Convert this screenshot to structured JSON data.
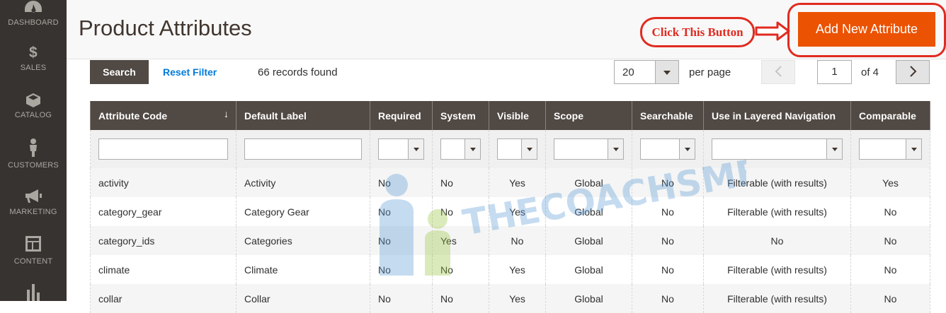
{
  "sidebar": {
    "items": [
      {
        "label": "DASHBOARD",
        "icon": "dashboard-icon"
      },
      {
        "label": "SALES",
        "icon": "dollar-icon"
      },
      {
        "label": "CATALOG",
        "icon": "box-icon"
      },
      {
        "label": "CUSTOMERS",
        "icon": "person-icon"
      },
      {
        "label": "MARKETING",
        "icon": "megaphone-icon"
      },
      {
        "label": "CONTENT",
        "icon": "layout-icon"
      },
      {
        "label": "",
        "icon": "bar-chart-icon"
      }
    ]
  },
  "header": {
    "title": "Product Attributes",
    "annotation": "Click This Button",
    "add_button": "Add New Attribute"
  },
  "toolbar": {
    "search_label": "Search",
    "reset_label": "Reset Filter",
    "records": "66 records found",
    "per_page_value": "20",
    "per_page_label": "per page",
    "current_page": "1",
    "of_pages": "of 4"
  },
  "grid": {
    "columns": [
      "Attribute Code",
      "Default Label",
      "Required",
      "System",
      "Visible",
      "Scope",
      "Searchable",
      "Use in Layered Navigation",
      "Comparable"
    ],
    "rows": [
      [
        "activity",
        "Activity",
        "No",
        "No",
        "Yes",
        "Global",
        "No",
        "Filterable (with results)",
        "Yes"
      ],
      [
        "category_gear",
        "Category Gear",
        "No",
        "No",
        "Yes",
        "Global",
        "No",
        "Filterable (with results)",
        "No"
      ],
      [
        "category_ids",
        "Categories",
        "No",
        "Yes",
        "No",
        "Global",
        "No",
        "No",
        "No"
      ],
      [
        "climate",
        "Climate",
        "No",
        "No",
        "Yes",
        "Global",
        "No",
        "Filterable (with results)",
        "No"
      ],
      [
        "collar",
        "Collar",
        "No",
        "No",
        "Yes",
        "Global",
        "No",
        "Filterable (with results)",
        "No"
      ]
    ]
  },
  "watermark": "THECOACHSMB",
  "colors": {
    "accent": "#eb5202",
    "annotation": "#e02b20",
    "sidebar": "#373330",
    "header_bg": "#514943"
  }
}
